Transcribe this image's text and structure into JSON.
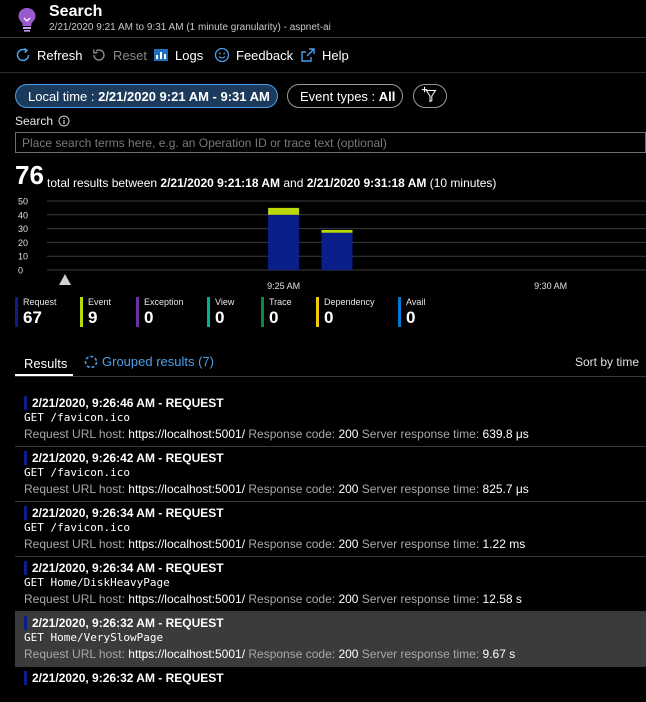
{
  "header": {
    "title": "Search",
    "subtitle": "2/21/2020 9:21 AM to 9:31 AM (1 minute granularity) - aspnet-ai",
    "icon": "lightbulb-icon",
    "icon_color": "#9b59d0"
  },
  "toolbar": {
    "refresh": "Refresh",
    "reset": "Reset",
    "logs": "Logs",
    "feedback": "Feedback",
    "help": "Help"
  },
  "filters": {
    "time_prefix": "Local time : ",
    "time_value": "2/21/2020 9:21 AM - 9:31 AM",
    "event_prefix": "Event types : ",
    "event_value": "All"
  },
  "search": {
    "label": "Search",
    "placeholder": "Place search terms here, e.g. an Operation ID or trace text (optional)",
    "value": ""
  },
  "summary": {
    "count": "76",
    "prefix": "total results between ",
    "start": "2/21/2020 9:21:18 AM",
    "mid": " and ",
    "end": "2/21/2020 9:31:18 AM",
    "suffix": " (10 minutes)"
  },
  "chart_data": {
    "type": "bar",
    "stacked": true,
    "categories": [
      "9:21 AM",
      "9:22 AM",
      "9:23 AM",
      "9:24 AM",
      "9:25 AM",
      "9:26 AM",
      "9:27 AM",
      "9:28 AM",
      "9:29 AM",
      "9:30 AM",
      "9:31 AM"
    ],
    "xtick_labels": [
      "9:25 AM",
      "9:30 AM"
    ],
    "yticks": [
      0,
      10,
      20,
      30,
      40,
      50
    ],
    "ylim": [
      0,
      50
    ],
    "grid": true,
    "series": [
      {
        "name": "Request",
        "color": "#0a1e8c",
        "values": [
          0,
          0,
          0,
          0,
          40,
          27,
          0,
          0,
          0,
          0,
          0
        ]
      },
      {
        "name": "Event",
        "color": "#bad80a",
        "values": [
          0,
          0,
          0,
          0,
          5,
          2,
          0,
          0,
          0,
          0,
          0
        ]
      }
    ]
  },
  "legend": [
    {
      "label": "Request",
      "value": "67",
      "color": "#0a1e8c"
    },
    {
      "label": "Event",
      "value": "9",
      "color": "#bad80a"
    },
    {
      "label": "Exception",
      "value": "0",
      "color": "#6b2fa0"
    },
    {
      "label": "View",
      "value": "0",
      "color": "#00b294"
    },
    {
      "label": "Trace",
      "value": "0",
      "color": "#10893e"
    },
    {
      "label": "Dependency",
      "value": "0",
      "color": "#f2c811"
    },
    {
      "label": "Avail",
      "value": "0",
      "color": "#0078d4"
    }
  ],
  "tabs": {
    "results": "Results",
    "grouped": "Grouped results (7)",
    "sort": "Sort by time"
  },
  "results": [
    {
      "header": "2/21/2020, 9:26:46 AM - REQUEST",
      "op": "GET /favicon.ico",
      "host_label": "Request URL host: ",
      "host": "https://localhost:5001/",
      "code_label": " Response code: ",
      "code": "200",
      "time_label": " Server response time: ",
      "time": "639.8 μs"
    },
    {
      "header": "2/21/2020, 9:26:42 AM - REQUEST",
      "op": "GET /favicon.ico",
      "host_label": "Request URL host: ",
      "host": "https://localhost:5001/",
      "code_label": " Response code: ",
      "code": "200",
      "time_label": " Server response time: ",
      "time": "825.7 μs"
    },
    {
      "header": "2/21/2020, 9:26:34 AM - REQUEST",
      "op": "GET /favicon.ico",
      "host_label": "Request URL host: ",
      "host": "https://localhost:5001/",
      "code_label": " Response code: ",
      "code": "200",
      "time_label": " Server response time: ",
      "time": "1.22 ms"
    },
    {
      "header": "2/21/2020, 9:26:34 AM - REQUEST",
      "op": "GET Home/DiskHeavyPage",
      "host_label": "Request URL host: ",
      "host": "https://localhost:5001/",
      "code_label": " Response code: ",
      "code": "200",
      "time_label": " Server response time: ",
      "time": "12.58 s"
    },
    {
      "header": "2/21/2020, 9:26:32 AM - REQUEST",
      "op": "GET Home/VerySlowPage",
      "host_label": "Request URL host: ",
      "host": "https://localhost:5001/",
      "code_label": " Response code: ",
      "code": "200",
      "time_label": " Server response time: ",
      "time": "9.67 s",
      "selected": true
    },
    {
      "header": "2/21/2020, 9:26:32 AM - REQUEST",
      "op": "",
      "host_label": "",
      "host": "",
      "code_label": "",
      "code": "",
      "time_label": "",
      "time": ""
    }
  ]
}
